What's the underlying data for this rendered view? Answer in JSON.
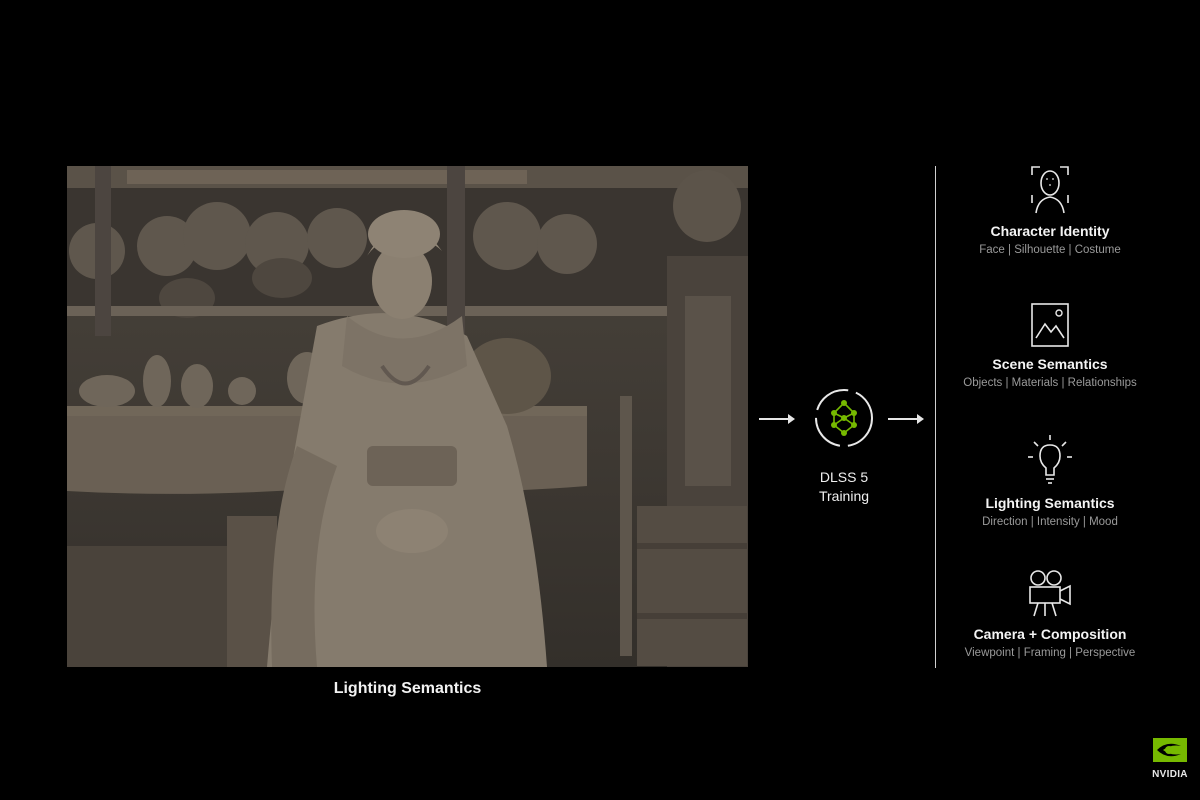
{
  "scene": {
    "caption": "Lighting Semantics"
  },
  "dlss": {
    "label_line1": "DLSS 5",
    "label_line2": "Training",
    "icon": "neural-network-icon"
  },
  "semantics": [
    {
      "title": "Character Identity",
      "subtitle": "Face | Silhouette | Costume",
      "icon": "face-scan-icon"
    },
    {
      "title": "Scene Semantics",
      "subtitle": "Objects | Materials | Relationships",
      "icon": "image-mountain-icon"
    },
    {
      "title": "Lighting Semantics",
      "subtitle": "Direction | Intensity | Mood",
      "icon": "lightbulb-icon"
    },
    {
      "title": "Camera + Composition",
      "subtitle": "Viewpoint | Framing | Perspective",
      "icon": "film-camera-icon"
    }
  ],
  "brand": {
    "name": "NVIDIA",
    "accent": "#76b900"
  }
}
